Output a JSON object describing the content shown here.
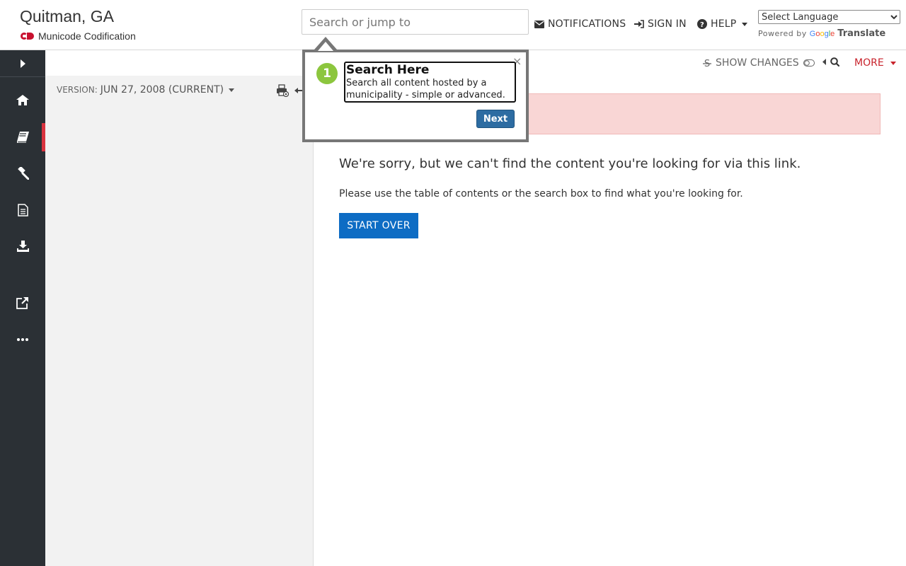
{
  "brand": {
    "title": "Quitman, GA",
    "subtitle": "Municode Codification"
  },
  "search": {
    "placeholder": "Search or jump to"
  },
  "header_nav": {
    "notifications": "NOTIFICATIONS",
    "sign_in": "SIGN IN",
    "help": "HELP"
  },
  "language": {
    "selected": "Select Language",
    "powered_by": "Powered by",
    "google": "Google",
    "translate": "Translate"
  },
  "rail": {
    "items": [
      "home-icon",
      "book-icon",
      "gavel-icon",
      "document-icon",
      "download-icon",
      "external-link-icon",
      "more-icon"
    ],
    "active_index": 1
  },
  "toc": {
    "version_label": "VERSION:",
    "version_value": "JUN 27, 2008 (CURRENT)"
  },
  "toolbar": {
    "show_changes": "SHOW CHANGES",
    "more": "MORE"
  },
  "content": {
    "sorry": "We're sorry, but we can't find the content you're looking for via this link.",
    "please": "Please use the table of contents or the search box to find what you're looking for.",
    "start_over": "START OVER"
  },
  "tour": {
    "step": "1",
    "close": "×",
    "title": "Search Here",
    "text": "Search all content hosted by a municipality - simple or advanced.",
    "next": "Next"
  },
  "colors": {
    "rail_bg": "#2b3035",
    "active_marker": "#d9333f",
    "primary_button": "#0d6cc4",
    "alert_bg": "#f9d6d5",
    "tour_badge": "#8cc63e",
    "more_accent": "#c8232c"
  }
}
